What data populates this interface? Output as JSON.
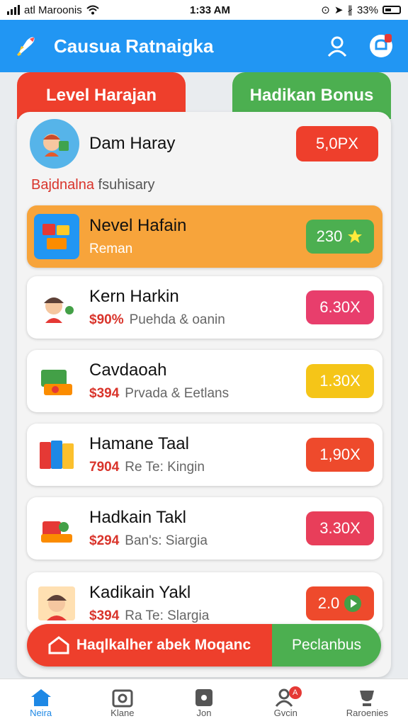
{
  "status": {
    "carrier": "atl Maroonis",
    "time": "1:33 AM",
    "battery": "33%"
  },
  "header": {
    "title": "Causua Ratnaigka"
  },
  "tabs": [
    {
      "label": "Level Harajan"
    },
    {
      "label": "Hadikan Bonus"
    }
  ],
  "profile": {
    "name": "Dam Haray",
    "value": "5,0PX"
  },
  "subtitle": {
    "accent": "Bajdnalna",
    "rest": " fsuhisary"
  },
  "items": [
    {
      "title": "Nevel Hafain",
      "price": "",
      "desc": "Reman",
      "value": "230",
      "color": "#4caf50"
    },
    {
      "title": "Kern Harkin",
      "price": "$90%",
      "desc": "Puehda & oanin",
      "value": "6.30X",
      "color": "#e83e6c"
    },
    {
      "title": "Cavdaoah",
      "price": "$394",
      "desc": "Prvada & Eetlans",
      "value": "1.30X",
      "color": "#f5c518"
    },
    {
      "title": "Hamane Taal",
      "price": "7904",
      "desc": "Re Te: Kingin",
      "value": "1,90X",
      "color": "#ee4a2c"
    },
    {
      "title": "Hadkain Takl",
      "price": "$294",
      "desc": "Ban's: Siargia",
      "value": "3.30X",
      "color": "#e83e5a"
    },
    {
      "title": "Kadikain Yakl",
      "price": "$394",
      "desc": "Ra Te: Slargia",
      "value": "2.0",
      "color": "#ee4a2c"
    }
  ],
  "action": {
    "left": "Haqlkalher abek Moqanc",
    "right": "Peclanbus"
  },
  "nav": [
    {
      "label": "Neira"
    },
    {
      "label": "Klane"
    },
    {
      "label": "Jon"
    },
    {
      "label": "Gvcin",
      "badge": "A"
    },
    {
      "label": "Raroenies"
    }
  ]
}
